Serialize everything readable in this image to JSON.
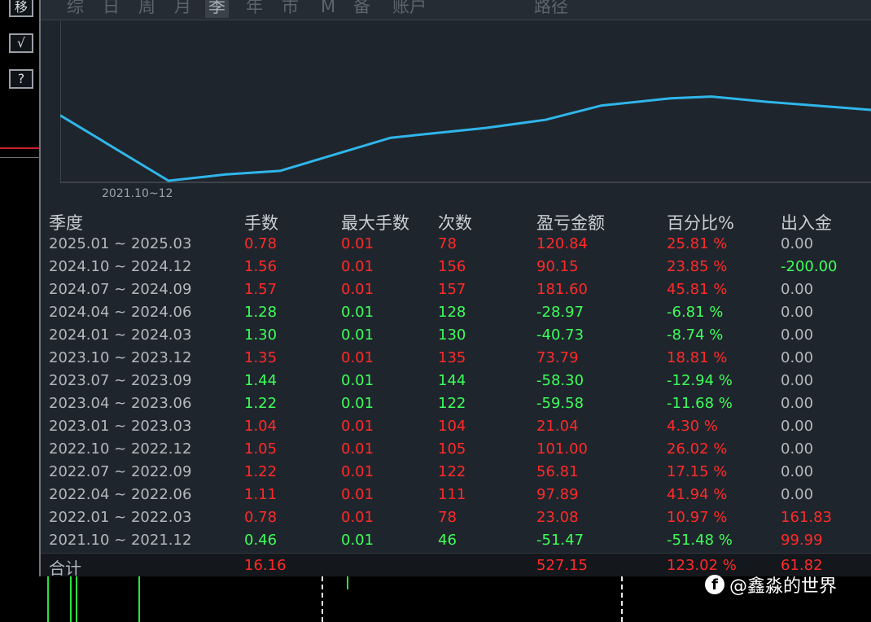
{
  "toolbar": {
    "buttons": [
      {
        "label": "移",
        "icon": "move-icon"
      },
      {
        "label": "√",
        "icon": "check-icon"
      },
      {
        "label": "?",
        "icon": "help-icon"
      }
    ]
  },
  "tabs": [
    "综",
    "日",
    "周",
    "月",
    "季",
    "年",
    "市",
    "M",
    "备",
    "账户",
    "路径"
  ],
  "active_tab": "季",
  "chart": {
    "x_label": "2021.10~12",
    "line_color": "#2fb6ea",
    "series_y": [
      0.73,
      0.0,
      0.07,
      0.11,
      0.48,
      0.59,
      0.68,
      0.84,
      0.92,
      0.94,
      0.88,
      0.79
    ]
  },
  "table": {
    "headers": [
      "季度",
      "手数",
      "最大手数",
      "次数",
      "盈亏金额",
      "百分比%",
      "出入金"
    ],
    "rows": [
      {
        "period": "2025.01 ~ 2025.03",
        "lots": "0.78",
        "max_lots": "0.01",
        "count": "78",
        "pnl": "120.84",
        "pct": "25.81 %",
        "flow": "0.00",
        "sign": "red",
        "flow_sign": "gray"
      },
      {
        "period": "2024.10 ~ 2024.12",
        "lots": "1.56",
        "max_lots": "0.01",
        "count": "156",
        "pnl": "90.15",
        "pct": "23.85 %",
        "flow": "-200.00",
        "sign": "red",
        "flow_sign": "green"
      },
      {
        "period": "2024.07 ~ 2024.09",
        "lots": "1.57",
        "max_lots": "0.01",
        "count": "157",
        "pnl": "181.60",
        "pct": "45.81 %",
        "flow": "0.00",
        "sign": "red",
        "flow_sign": "gray"
      },
      {
        "period": "2024.04 ~ 2024.06",
        "lots": "1.28",
        "max_lots": "0.01",
        "count": "128",
        "pnl": "-28.97",
        "pct": "-6.81 %",
        "flow": "0.00",
        "sign": "green",
        "flow_sign": "gray"
      },
      {
        "period": "2024.01 ~ 2024.03",
        "lots": "1.30",
        "max_lots": "0.01",
        "count": "130",
        "pnl": "-40.73",
        "pct": "-8.74 %",
        "flow": "0.00",
        "sign": "green",
        "flow_sign": "gray"
      },
      {
        "period": "2023.10 ~ 2023.12",
        "lots": "1.35",
        "max_lots": "0.01",
        "count": "135",
        "pnl": "73.79",
        "pct": "18.81 %",
        "flow": "0.00",
        "sign": "red",
        "flow_sign": "gray"
      },
      {
        "period": "2023.07 ~ 2023.09",
        "lots": "1.44",
        "max_lots": "0.01",
        "count": "144",
        "pnl": "-58.30",
        "pct": "-12.94 %",
        "flow": "0.00",
        "sign": "green",
        "flow_sign": "gray"
      },
      {
        "period": "2023.04 ~ 2023.06",
        "lots": "1.22",
        "max_lots": "0.01",
        "count": "122",
        "pnl": "-59.58",
        "pct": "-11.68 %",
        "flow": "0.00",
        "sign": "green",
        "flow_sign": "gray"
      },
      {
        "period": "2023.01 ~ 2023.03",
        "lots": "1.04",
        "max_lots": "0.01",
        "count": "104",
        "pnl": "21.04",
        "pct": "4.30 %",
        "flow": "0.00",
        "sign": "red",
        "flow_sign": "gray"
      },
      {
        "period": "2022.10 ~ 2022.12",
        "lots": "1.05",
        "max_lots": "0.01",
        "count": "105",
        "pnl": "101.00",
        "pct": "26.02 %",
        "flow": "0.00",
        "sign": "red",
        "flow_sign": "gray"
      },
      {
        "period": "2022.07 ~ 2022.09",
        "lots": "1.22",
        "max_lots": "0.01",
        "count": "122",
        "pnl": "56.81",
        "pct": "17.15 %",
        "flow": "0.00",
        "sign": "red",
        "flow_sign": "gray"
      },
      {
        "period": "2022.04 ~ 2022.06",
        "lots": "1.11",
        "max_lots": "0.01",
        "count": "111",
        "pnl": "97.89",
        "pct": "41.94 %",
        "flow": "0.00",
        "sign": "red",
        "flow_sign": "gray"
      },
      {
        "period": "2022.01 ~ 2022.03",
        "lots": "0.78",
        "max_lots": "0.01",
        "count": "78",
        "pnl": "23.08",
        "pct": "10.97 %",
        "flow": "161.83",
        "sign": "red",
        "flow_sign": "red"
      },
      {
        "period": "2021.10 ~ 2021.12",
        "lots": "0.46",
        "max_lots": "0.01",
        "count": "46",
        "pnl": "-51.47",
        "pct": "-51.48 %",
        "flow": "99.99",
        "sign": "green",
        "flow_sign": "red"
      }
    ],
    "total": {
      "label": "合计",
      "lots": "16.16",
      "pnl": "527.15",
      "pct": "123.02 %",
      "flow": "61.82"
    }
  },
  "watermark": {
    "text": "@鑫淼的世界",
    "icon": "facebook-icon"
  },
  "colors": {
    "red": "#ff2a2a",
    "green": "#3cff5a",
    "line": "#2fb6ea"
  }
}
